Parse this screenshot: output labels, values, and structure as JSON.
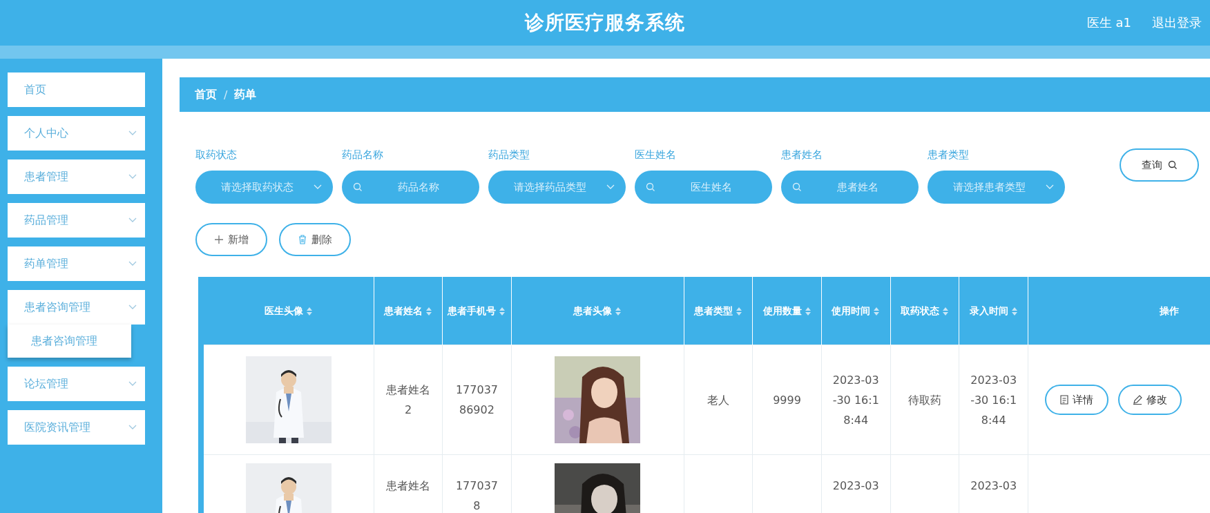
{
  "header": {
    "title": "诊所医疗服务系统",
    "user": "医生 a1",
    "logout": "退出登录"
  },
  "sidebar": {
    "items": [
      {
        "label": "首页",
        "kind": "link"
      },
      {
        "label": "个人中心",
        "kind": "menu"
      },
      {
        "label": "患者管理",
        "kind": "menu"
      },
      {
        "label": "药品管理",
        "kind": "menu"
      },
      {
        "label": "药单管理",
        "kind": "menu"
      },
      {
        "label": "患者咨询管理",
        "kind": "menu",
        "children": [
          {
            "label": "患者咨询管理"
          }
        ]
      },
      {
        "label": "论坛管理",
        "kind": "menu"
      },
      {
        "label": "医院资讯管理",
        "kind": "menu"
      }
    ]
  },
  "breadcrumb": {
    "items": [
      "首页",
      "药单"
    ],
    "separator": "/"
  },
  "filters": [
    {
      "label": "取药状态",
      "kind": "select",
      "placeholder": "请选择取药状态"
    },
    {
      "label": "药品名称",
      "kind": "search",
      "placeholder": "药品名称"
    },
    {
      "label": "药品类型",
      "kind": "select",
      "placeholder": "请选择药品类型"
    },
    {
      "label": "医生姓名",
      "kind": "search",
      "placeholder": "医生姓名"
    },
    {
      "label": "患者姓名",
      "kind": "search",
      "placeholder": "患者姓名"
    },
    {
      "label": "患者类型",
      "kind": "select",
      "placeholder": "请选择患者类型"
    }
  ],
  "search_button": "查询",
  "actions": [
    {
      "label": "新增",
      "kind": "add"
    },
    {
      "label": "删除",
      "kind": "delete"
    }
  ],
  "table": {
    "columns": [
      {
        "label": "医生头像",
        "kind": "picture",
        "sortable": true
      },
      {
        "label": "患者姓名",
        "kind": "text",
        "sortable": true
      },
      {
        "label": "患者手机号",
        "kind": "text",
        "sortable": true
      },
      {
        "label": "患者头像",
        "kind": "picture",
        "sortable": true
      },
      {
        "label": "患者类型",
        "kind": "text",
        "sortable": true
      },
      {
        "label": "使用数量",
        "kind": "text",
        "sortable": true
      },
      {
        "label": "使用时间",
        "kind": "text",
        "sortable": true
      },
      {
        "label": "取药状态",
        "kind": "text",
        "sortable": true
      },
      {
        "label": "录入时间",
        "kind": "text",
        "sortable": true
      },
      {
        "label": "操作",
        "kind": "actions",
        "sortable": false
      }
    ],
    "rows": [
      {
        "cells": [
          {
            "kind": "picture"
          },
          "患者姓名2",
          "17703786902",
          {
            "kind": "picture"
          },
          "老人",
          "9999",
          "2023-03-30 16:18:44",
          "待取药",
          "2023-03-30 16:18:44",
          [
            {
              "label": "详情",
              "kind": "detail"
            },
            {
              "label": "修改",
              "kind": "edit"
            }
          ]
        ]
      },
      {
        "cells": [
          {
            "kind": "picture"
          },
          "患者姓名",
          "1770378",
          {
            "kind": "picture"
          },
          null,
          null,
          "2023-03",
          null,
          "2023-03",
          null
        ]
      }
    ]
  }
}
